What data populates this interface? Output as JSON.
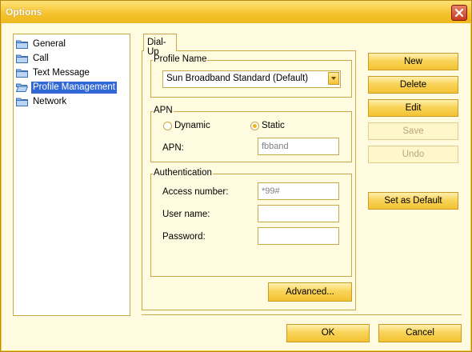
{
  "window": {
    "title": "Options"
  },
  "tree": {
    "items": [
      {
        "label": "General",
        "selected": false
      },
      {
        "label": "Call",
        "selected": false
      },
      {
        "label": "Text Message",
        "selected": false
      },
      {
        "label": "Profile Management",
        "selected": true
      },
      {
        "label": "Network",
        "selected": false
      }
    ]
  },
  "tabs": [
    {
      "label": "Dial-Up",
      "active": true
    }
  ],
  "profile": {
    "group_label": "Profile Name",
    "selected": "Sun Broadband Standard (Default)"
  },
  "apn": {
    "group_label": "APN",
    "dynamic_label": "Dynamic",
    "static_label": "Static",
    "selected_mode": "Static",
    "apn_label": "APN:",
    "apn_value": "fbband"
  },
  "auth": {
    "group_label": "Authentication",
    "access_label": "Access number:",
    "access_value": "*99#",
    "user_label": "User name:",
    "user_value": "",
    "password_label": "Password:",
    "password_value": ""
  },
  "buttons": {
    "advanced": "Advanced...",
    "new": "New",
    "delete": "Delete",
    "edit": "Edit",
    "save": "Save",
    "undo": "Undo",
    "set_default": "Set as Default",
    "ok": "OK",
    "cancel": "Cancel"
  },
  "colors": {
    "window": "#f7ce3f",
    "client": "#fffbe0",
    "selection": "#3168d5",
    "close": "#c83a20"
  }
}
